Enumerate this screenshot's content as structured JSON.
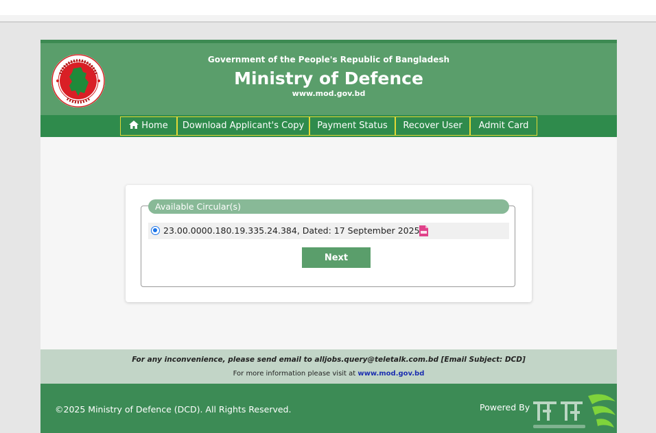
{
  "header": {
    "government": "Government of the People's Republic of Bangladesh",
    "ministry": "Ministry of Defence",
    "website": "www.mod.gov.bd"
  },
  "nav": {
    "home": "Home",
    "download": "Download Applicant's Copy",
    "payment": "Payment Status",
    "recover": "Recover User",
    "admit": "Admit Card"
  },
  "circular": {
    "legend": "Available Circular(s)",
    "item": "23.00.0000.180.19.335.24.384, Dated: 17 September 2025",
    "selected": true,
    "next_label": "Next"
  },
  "info": {
    "line1": "For any inconvenience, please send email to alljobs.query@teletalk.com.bd [Email Subject: DCD]",
    "line2_prefix": "For more information please visit at ",
    "line2_link": "www.mod.gov.bd"
  },
  "footer": {
    "copyright": "©2025 Ministry of Defence (DCD). All Rights Reserved.",
    "powered_by": "Powered By"
  },
  "colors": {
    "header_bg": "#5a9e6b",
    "nav_bg": "#2f8b4c",
    "nav_border": "#e3d936",
    "footer_bg": "#3c8b55",
    "info_bg": "#c2d5c7"
  },
  "icons": {
    "logo": "bangladesh-government-seal",
    "home": "home-icon",
    "pdf": "pdf-icon",
    "teletalk": "teletalk-logo"
  }
}
